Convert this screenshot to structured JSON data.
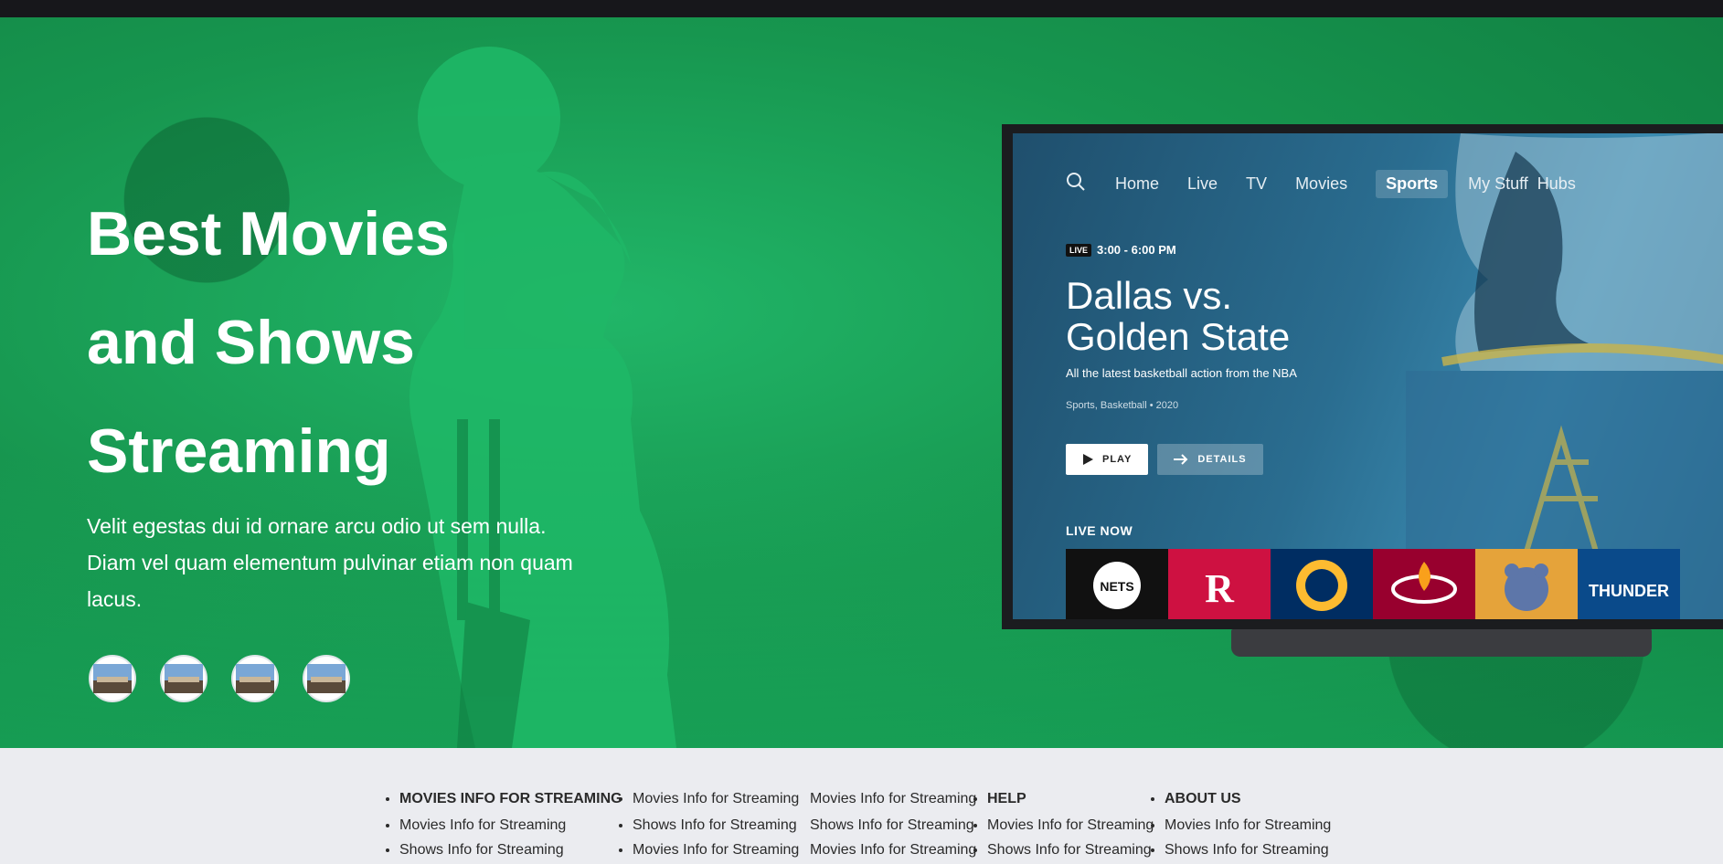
{
  "hero": {
    "title_lines": [
      "Best Movies",
      "and Shows",
      "Streaming"
    ],
    "description": "Velit egestas dui id ornare arcu odio ut sem nulla. Diam vel quam elementum pulvinar etiam non quam lacus.",
    "thumbnail_count": 4,
    "background_color": "#17964f"
  },
  "tv": {
    "nav": {
      "items": [
        "Home",
        "Live",
        "TV",
        "Movies",
        "Sports",
        "My Stuff",
        "Hubs"
      ],
      "active": "Sports"
    },
    "live_badge": "LIVE",
    "time": "3:00 - 6:00 PM",
    "title_line1": "Dallas vs.",
    "title_line2": "Golden State",
    "subtitle": "All the latest basketball action from the NBA",
    "meta": "Sports, Basketball  •  2020",
    "play_label": "PLAY",
    "details_label": "DETAILS",
    "live_now_label": "LIVE NOW",
    "tiles": [
      {
        "team": "NETS",
        "color": "#111111"
      },
      {
        "team": "R",
        "color": "#ce1141"
      },
      {
        "team": "PACERS",
        "color": "#002d62"
      },
      {
        "team": "HEAT",
        "color": "#98002e"
      },
      {
        "team": "GRIZZLIES",
        "color": "#e5a33a"
      },
      {
        "team": "THUNDER",
        "color": "#0a4a8a"
      }
    ]
  },
  "footer": {
    "columns": [
      {
        "heading": "MOVIES INFO FOR STREAMING",
        "items": [
          "Movies Info for Streaming",
          "Shows Info for Streaming"
        ]
      },
      {
        "items": [
          "Movies Info for Streaming",
          "Shows Info for Streaming",
          "Movies Info for Streaming"
        ]
      },
      {
        "items": [
          "Movies Info for Streaming",
          "Shows Info for Streaming",
          "Movies Info for Streaming"
        ]
      },
      {
        "heading": "HELP",
        "items": [
          "Movies Info for Streaming",
          "Shows Info for Streaming"
        ]
      },
      {
        "heading": "ABOUT US",
        "items": [
          "Movies Info for Streaming",
          "Shows Info for Streaming"
        ]
      }
    ]
  }
}
